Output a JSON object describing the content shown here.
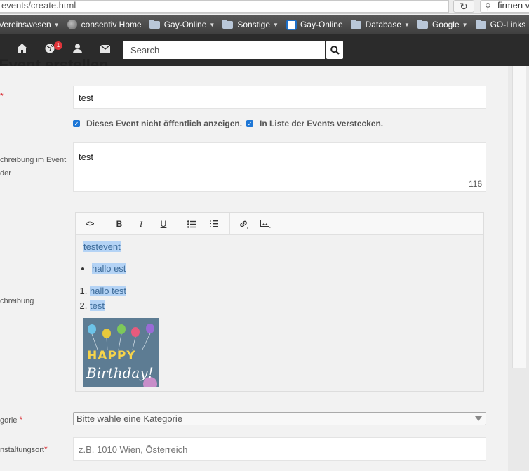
{
  "browser": {
    "url": "events/create.html",
    "search_value": "firmen v",
    "bookmarks": [
      {
        "label": "Vereinswesen",
        "icon": "none",
        "caret": true
      },
      {
        "label": "consentiv Home",
        "icon": "globe-icon",
        "caret": false
      },
      {
        "label": "Gay-Online",
        "icon": "folder-icon",
        "caret": true
      },
      {
        "label": "Sonstige",
        "icon": "folder-icon",
        "caret": true
      },
      {
        "label": "Gay-Online",
        "icon": "site-icon",
        "caret": false
      },
      {
        "label": "Database",
        "icon": "folder-icon",
        "caret": true
      },
      {
        "label": "Google",
        "icon": "folder-icon",
        "caret": true
      },
      {
        "label": "GO-Links",
        "icon": "folder-icon",
        "caret": false
      }
    ]
  },
  "navbar": {
    "notification_count": "1",
    "search_placeholder": "Search"
  },
  "page": {
    "title": "Event erstellen"
  },
  "form": {
    "name_required": "*",
    "name_value": "test",
    "checkbox_hide_public": "Dieses Event nicht öffentlich anzeigen.",
    "checkbox_hide_list": "In Liste der Events verstecken.",
    "short_desc_label_1": "chreibung im Event",
    "short_desc_label_2": "der",
    "short_desc_value": "test",
    "short_desc_counter": "116",
    "desc_label": "chreibung",
    "editor": {
      "paragraph": "testevent",
      "bullet_items": [
        "hallo est"
      ],
      "ordered_items": [
        "hallo test",
        "test"
      ],
      "image_text": "Birthday!",
      "image_letters": "HAPPY"
    },
    "category_label": "gorie",
    "category_required": "*",
    "category_value": "Bitte wähle eine Kategorie",
    "venue_label": "nstaltungsort",
    "venue_required": "*",
    "venue_placeholder": "z.B. 1010 Wien, Österreich"
  },
  "colors": {
    "accent": "#1e77d6",
    "navbar": "#2b2b2b",
    "badge": "#e0343a",
    "selection": "#b4d3f5"
  }
}
